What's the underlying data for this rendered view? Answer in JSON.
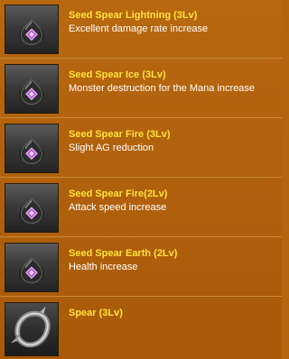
{
  "items": [
    {
      "title": "Seed Spear Lightning (3Lv)",
      "description": "Excellent damage rate increase",
      "icon": "seed-icon"
    },
    {
      "title": "Seed Spear Ice (3Lv)",
      "description": "Monster destruction for the Mana increase",
      "icon": "seed-icon"
    },
    {
      "title": "Seed Spear Fire (3Lv)",
      "description": "Slight AG reduction",
      "icon": "seed-icon"
    },
    {
      "title": "Seed Spear Fire(2Lv)",
      "description": "Attack speed increase",
      "icon": "seed-icon"
    },
    {
      "title": "Seed Spear Earth (2Lv)",
      "description": "Health increase",
      "icon": "seed-icon"
    },
    {
      "title": "Spear  (3Lv)",
      "description": "",
      "icon": "spear-ring-icon"
    }
  ],
  "colors": {
    "background": "#b1610c",
    "title": "#ffe23c",
    "description": "#ffffff",
    "gem": "#c05ae0"
  }
}
